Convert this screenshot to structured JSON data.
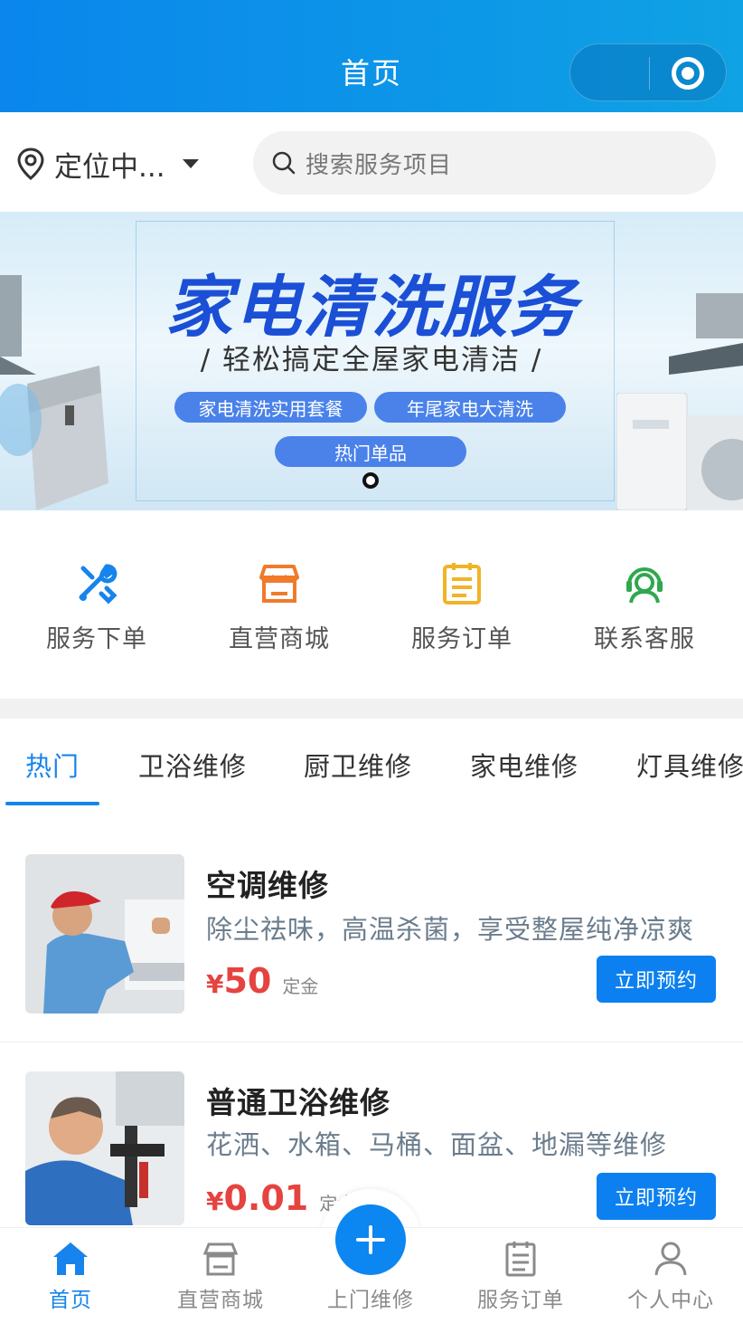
{
  "header": {
    "title": "首页"
  },
  "location": {
    "label": "定位中..."
  },
  "search": {
    "placeholder": "搜索服务项目"
  },
  "banner": {
    "title": "家电清洗服务",
    "subtitle": "/ 轻松搞定全屋家电清洁 /",
    "pills": [
      "家电清洗实用套餐",
      "年尾家电大清洗",
      "热门单品"
    ],
    "title_color": "#1a4fd6",
    "pill_color": "#4a82ea"
  },
  "quick_menu": [
    {
      "label": "服务下单",
      "icon": "tools-icon",
      "color": "#1684ec"
    },
    {
      "label": "直营商城",
      "icon": "store-icon",
      "color": "#f07b2b"
    },
    {
      "label": "服务订单",
      "icon": "clipboard-icon",
      "color": "#f0b428"
    },
    {
      "label": "联系客服",
      "icon": "headset-icon",
      "color": "#2fa84f"
    }
  ],
  "tabs": [
    "热门",
    "卫浴维修",
    "厨卫维修",
    "家电维修",
    "灯具维修"
  ],
  "active_tab": "热门",
  "services": [
    {
      "name": "空调维修",
      "desc": "除尘祛味，高温杀菌，享受整屋纯净凉爽",
      "currency": "¥",
      "price": "50",
      "unit": "定金",
      "button": "立即预约"
    },
    {
      "name": "普通卫浴维修",
      "desc": "花洒、水箱、马桶、面盆、地漏等维修",
      "currency": "¥",
      "price": "0.01",
      "unit": "定金",
      "button": "立即预约"
    }
  ],
  "bottom_nav": [
    {
      "label": "首页",
      "icon": "home-icon",
      "active": true
    },
    {
      "label": "直营商城",
      "icon": "store-icon",
      "active": false
    },
    {
      "label": "上门维修",
      "icon": "plus-icon",
      "active": false
    },
    {
      "label": "服务订单",
      "icon": "clipboard-icon",
      "active": false
    },
    {
      "label": "个人中心",
      "icon": "user-icon",
      "active": false
    }
  ],
  "colors": {
    "accent": "#1684ec",
    "price": "#e5433f",
    "header_start": "#0a86ec",
    "header_end": "#0fa2e4"
  }
}
